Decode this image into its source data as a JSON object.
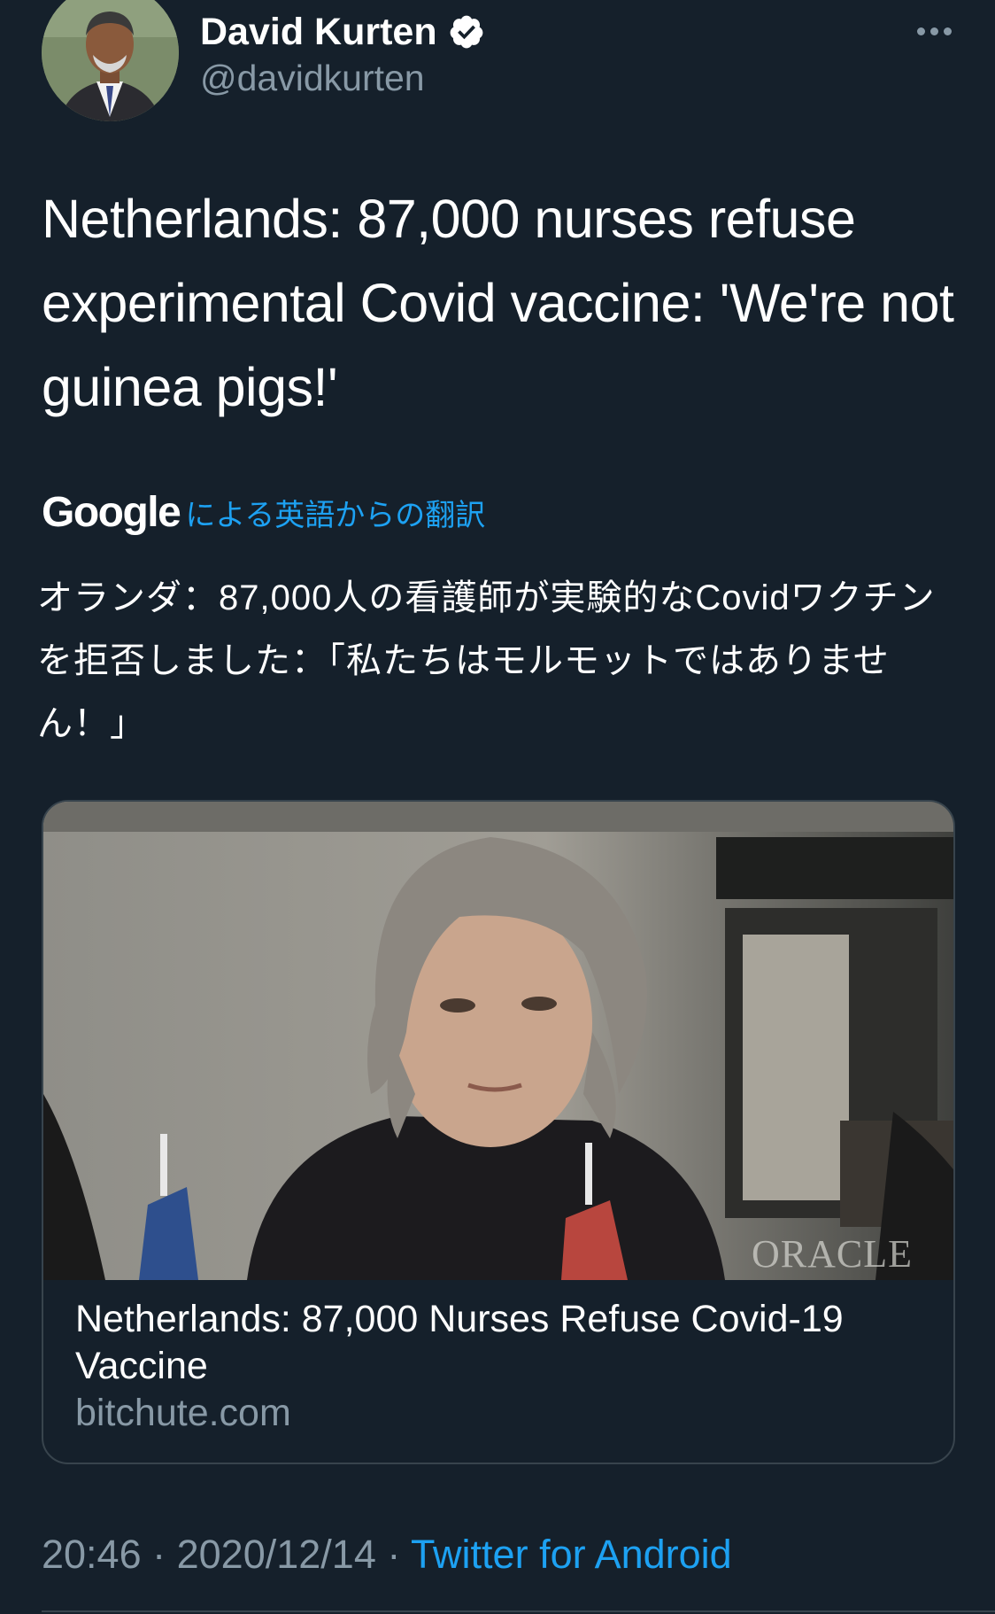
{
  "tweet": {
    "author": {
      "name": "David Kurten",
      "handle": "@davidkurten",
      "verified": true
    },
    "text": "Netherlands: 87,000 nurses refuse experimental Covid vaccine: 'We're not guinea pigs!'",
    "translation": {
      "provider": "Google",
      "label": "による英語からの翻訳",
      "text": "オランダ：87,000人の看護師が実験的なCovidワクチンを拒否しました：「私たちはモルモットではありません！」"
    },
    "card": {
      "image_watermark": "ORACLE",
      "title": "Netherlands: 87,000 Nurses Refuse Covid-19 Vaccine",
      "domain": "bitchute.com"
    },
    "meta": {
      "time": "20:46",
      "separator": " · ",
      "date": "2020/12/14",
      "source": "Twitter for Android"
    }
  },
  "icons": {
    "verified": "verified-badge-icon",
    "more": "more-options-icon"
  },
  "colors": {
    "background": "#15202b",
    "text": "#ffffff",
    "secondary_text": "#8899a6",
    "accent": "#1da1f2",
    "border": "#38444d"
  }
}
